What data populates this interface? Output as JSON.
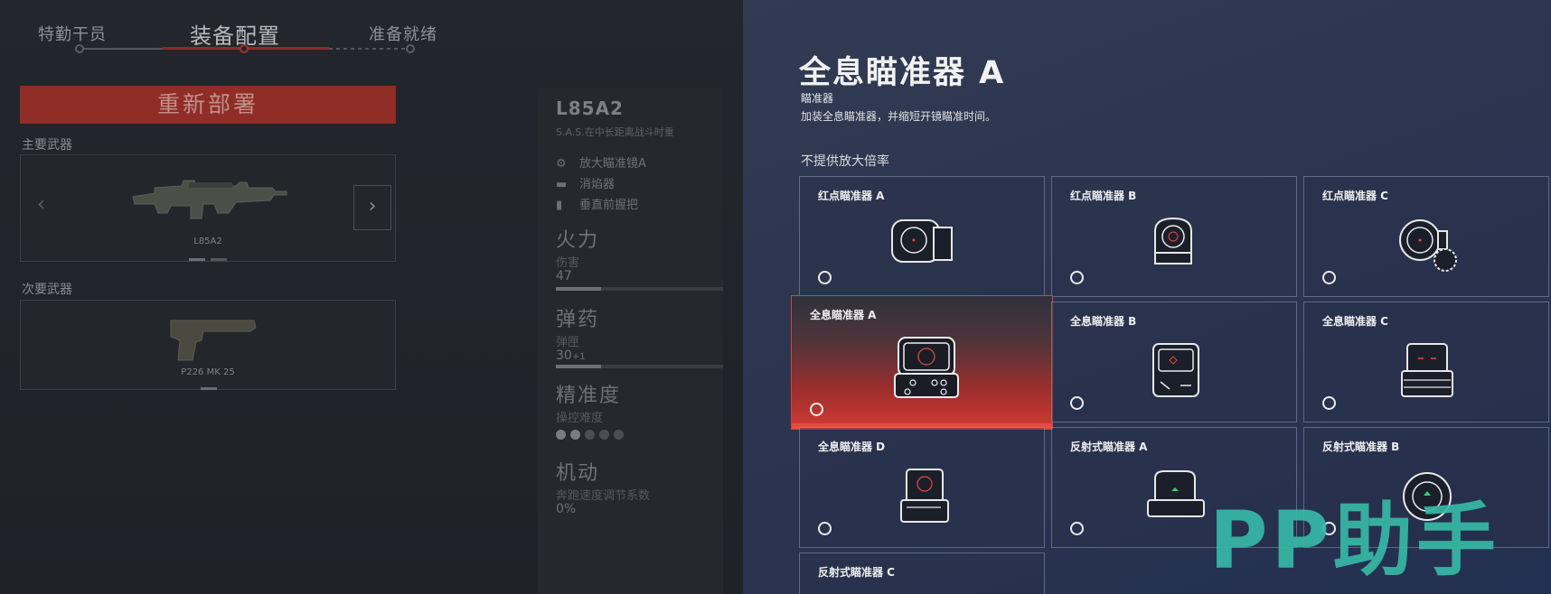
{
  "steps": {
    "s1": "特勤干员",
    "s2": "装备配置",
    "s3": "准备就绪"
  },
  "left": {
    "redeploy": "重新部署",
    "primary_label": "主要武器",
    "primary_name": "L85A2",
    "secondary_label": "次要武器",
    "secondary_name": "P226 MK 25",
    "prev_arrow": "‹",
    "next_arrow": "›"
  },
  "stats": {
    "weapon": "L85A2",
    "desc": "S.A.S.在中长距离战斗时重",
    "attachments": [
      {
        "icon": "scope-icon",
        "label": "放大瞄准镜A"
      },
      {
        "icon": "suppressor-icon",
        "label": "消焰器"
      },
      {
        "icon": "grip-icon",
        "label": "垂直前握把"
      }
    ],
    "firepower": {
      "title": "火力",
      "sub": "伤害",
      "value": "47",
      "level": 0.27
    },
    "ammo": {
      "title": "弹药",
      "sub": "弹匣",
      "value": "30",
      "extra": "+1",
      "level": 0.27
    },
    "accuracy": {
      "title": "精准度",
      "sub": "操控难度",
      "dots_on": 2,
      "dots_total": 5
    },
    "mobility": {
      "title": "机动",
      "sub": "奔跑速度调节系数",
      "value": "0%"
    }
  },
  "right": {
    "title": "全息瞄准器 A",
    "type": "瞄准器",
    "desc": "加装全息瞄准器，并缩短开镜瞄准时间。",
    "section": "不提供放大倍率",
    "cards": [
      {
        "name": "红点瞄准器 A",
        "icon": "red-dot-sight-a-icon",
        "selected": false
      },
      {
        "name": "红点瞄准器 B",
        "icon": "red-dot-sight-b-icon",
        "selected": false
      },
      {
        "name": "红点瞄准器 C",
        "icon": "red-dot-sight-c-icon",
        "selected": false
      },
      {
        "name": "全息瞄准器 A",
        "icon": "holo-sight-a-icon",
        "selected": true
      },
      {
        "name": "全息瞄准器 B",
        "icon": "holo-sight-b-icon",
        "selected": false
      },
      {
        "name": "全息瞄准器 C",
        "icon": "holo-sight-c-icon",
        "selected": false
      },
      {
        "name": "全息瞄准器 D",
        "icon": "holo-sight-d-icon",
        "selected": false
      },
      {
        "name": "反射式瞄准器 A",
        "icon": "reflex-sight-a-icon",
        "selected": false
      },
      {
        "name": "反射式瞄准器 B",
        "icon": "reflex-sight-b-icon",
        "selected": false
      },
      {
        "name": "反射式瞄准器 C",
        "icon": "reflex-sight-c-icon",
        "selected": false
      }
    ]
  },
  "watermark": "PP助手",
  "colors": {
    "accent_red": "#e84a3d",
    "panel_blue": "#2c3550",
    "watermark_teal": "#37b8a6"
  }
}
